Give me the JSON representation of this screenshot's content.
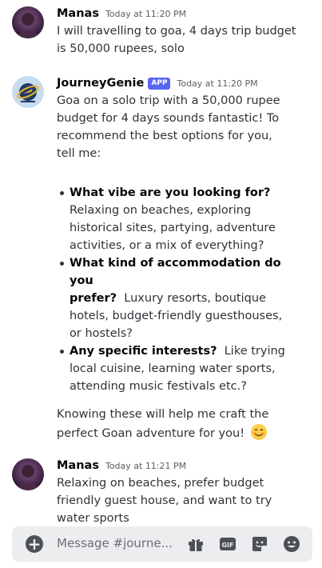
{
  "messages": [
    {
      "author": "Manas",
      "timestamp": "Today at 11:20 PM",
      "lines": [
        "I will travelling to goa, 4 days trip budget",
        "is 50,000 rupees, solo"
      ]
    },
    {
      "author": "JourneyGenie",
      "badge": "APP",
      "timestamp": "Today at 11:20 PM",
      "intro_lines": [
        "Goa on a solo trip with a 50,000 rupee",
        "budget for 4 days sounds fantastic!  To",
        "recommend the best options for you,",
        "tell me:"
      ],
      "bullets": [
        {
          "bold": "What vibe are you looking for?",
          "lines": [
            "Relaxing on beaches, exploring",
            "historical sites, partying, adventure",
            "activities, or a mix of everything?"
          ]
        },
        {
          "bold_lines": [
            "What kind of accommodation do you",
            "prefer?"
          ],
          "rest_first": "  Luxury resorts, boutique",
          "lines": [
            "hotels, budget-friendly guesthouses,",
            "or hostels?"
          ]
        },
        {
          "bold": "Any specific interests?",
          "rest_first": "  Like trying",
          "lines": [
            "local cuisine, learning water sports,",
            "attending music festivals etc.?"
          ]
        }
      ],
      "outro_lines": [
        "Knowing these will help me craft the",
        "perfect Goan adventure for you! "
      ],
      "emoji": "smiling-face-icon"
    },
    {
      "author": "Manas",
      "timestamp": "Today at 11:21 PM",
      "lines": [
        "Relaxing on beaches, prefer budget",
        "friendly guest house, and want to try",
        "water sports"
      ]
    }
  ],
  "composer": {
    "placeholder": "Message #journe...",
    "icons": [
      "add-icon",
      "gift-icon",
      "gif-icon",
      "sticker-icon",
      "emoji-icon"
    ]
  }
}
